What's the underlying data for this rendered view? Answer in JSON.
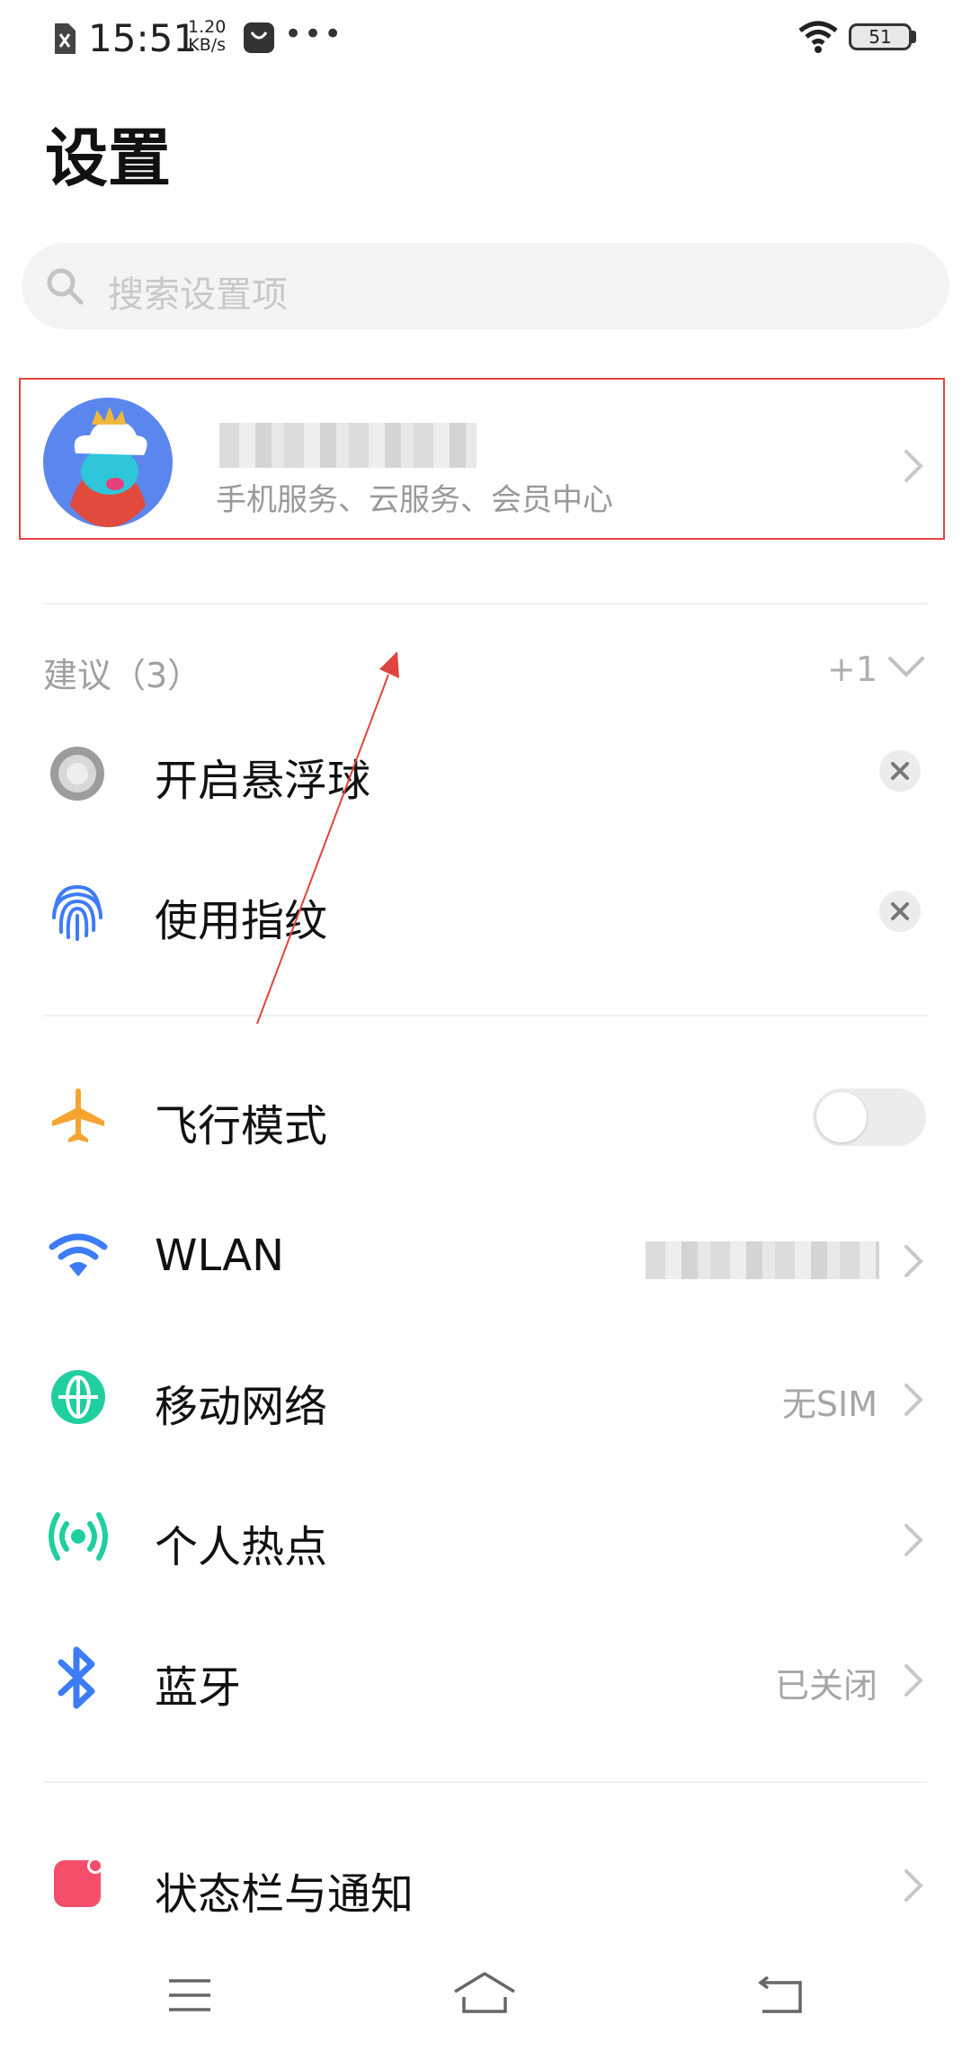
{
  "status_bar": {
    "time": "15:51",
    "speed_value": "1.20",
    "speed_unit": "KB/s",
    "more": "•••",
    "battery": "51"
  },
  "header": {
    "title": "设置"
  },
  "search": {
    "placeholder": "搜索设置项"
  },
  "account": {
    "subtitle": "手机服务、云服务、会员中心"
  },
  "suggestions": {
    "label": "建议（3）",
    "extra": "+1",
    "items": [
      {
        "label": "开启悬浮球",
        "icon": "floating-ball-icon"
      },
      {
        "label": "使用指纹",
        "icon": "fingerprint-icon"
      }
    ]
  },
  "settings": [
    {
      "label": "飞行模式",
      "icon": "airplane-icon",
      "control": "toggle",
      "on": false
    },
    {
      "label": "WLAN",
      "icon": "wifi-icon",
      "value": ""
    },
    {
      "label": "移动网络",
      "icon": "globe-icon",
      "value": "无SIM"
    },
    {
      "label": "个人热点",
      "icon": "hotspot-icon",
      "value": ""
    },
    {
      "label": "蓝牙",
      "icon": "bluetooth-icon",
      "value": "已关闭"
    },
    {
      "label": "状态栏与通知",
      "icon": "notification-icon",
      "value": ""
    }
  ],
  "colors": {
    "accent_blue": "#3d7cf5",
    "airplane_orange": "#f5a430",
    "network_teal": "#1fcf9f",
    "notification_red": "#f44e6a",
    "annotation_red": "#e0443e"
  }
}
